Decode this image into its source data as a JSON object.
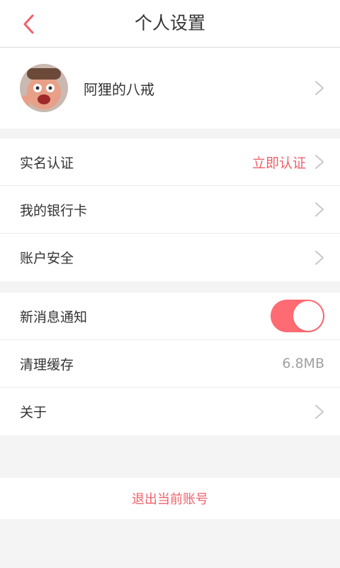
{
  "header": {
    "title": "个人设置",
    "back_icon": "chevron-left-icon",
    "accent_color": "#f0606a"
  },
  "profile": {
    "username": "阿狸的八戒",
    "avatar": "avatar-photo"
  },
  "group1": [
    {
      "label": "实名认证",
      "value": "立即认证"
    },
    {
      "label": "我的银行卡"
    },
    {
      "label": "账户安全"
    }
  ],
  "group2": {
    "notify": {
      "label": "新消息通知",
      "enabled": true
    },
    "cache": {
      "label": "清理缓存",
      "value": "6.8MB"
    },
    "about": {
      "label": "关于"
    }
  },
  "logout": {
    "label": "退出当前账号"
  }
}
